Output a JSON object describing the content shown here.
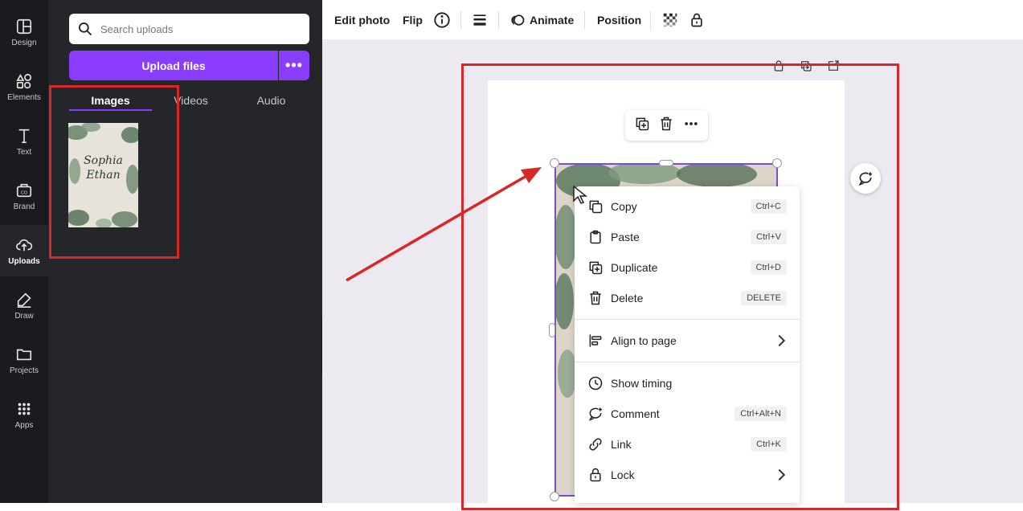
{
  "rail": {
    "items": [
      {
        "label": "Design",
        "icon": "layout-icon"
      },
      {
        "label": "Elements",
        "icon": "shapes-icon"
      },
      {
        "label": "Text",
        "icon": "text-icon"
      },
      {
        "label": "Brand",
        "icon": "brand-icon"
      },
      {
        "label": "Uploads",
        "icon": "cloud-upload-icon"
      },
      {
        "label": "Draw",
        "icon": "pen-icon"
      },
      {
        "label": "Projects",
        "icon": "folder-icon"
      },
      {
        "label": "Apps",
        "icon": "grid-icon"
      }
    ],
    "active": "Uploads"
  },
  "panel": {
    "search_placeholder": "Search uploads",
    "upload_label": "Upload files",
    "more_label": "•••",
    "tabs": [
      {
        "label": "Images",
        "active": true
      },
      {
        "label": "Videos",
        "active": false
      },
      {
        "label": "Audio",
        "active": false
      }
    ],
    "thumbnail": {
      "line1": "Sophia",
      "line2": "Ethan"
    }
  },
  "toolbar": {
    "edit_photo": "Edit photo",
    "flip": "Flip",
    "animate": "Animate",
    "position": "Position"
  },
  "context_menu": {
    "items": [
      {
        "label": "Copy",
        "shortcut": "Ctrl+C",
        "icon": "copy-icon"
      },
      {
        "label": "Paste",
        "shortcut": "Ctrl+V",
        "icon": "clipboard-icon"
      },
      {
        "label": "Duplicate",
        "shortcut": "Ctrl+D",
        "icon": "duplicate-icon"
      },
      {
        "label": "Delete",
        "shortcut": "DELETE",
        "icon": "trash-icon"
      },
      {
        "label": "Align to page",
        "submenu": true,
        "icon": "align-icon"
      },
      {
        "label": "Show timing",
        "icon": "clock-icon"
      },
      {
        "label": "Comment",
        "shortcut": "Ctrl+Alt+N",
        "icon": "comment-icon"
      },
      {
        "label": "Link",
        "shortcut": "Ctrl+K",
        "icon": "link-icon"
      },
      {
        "label": "Lock",
        "submenu": true,
        "icon": "lock-icon"
      }
    ]
  },
  "colors": {
    "accent_purple": "#8b3dff",
    "annotation_red": "#d92626",
    "rail_bg": "#1a1b1e",
    "panel_bg": "#25262a"
  }
}
